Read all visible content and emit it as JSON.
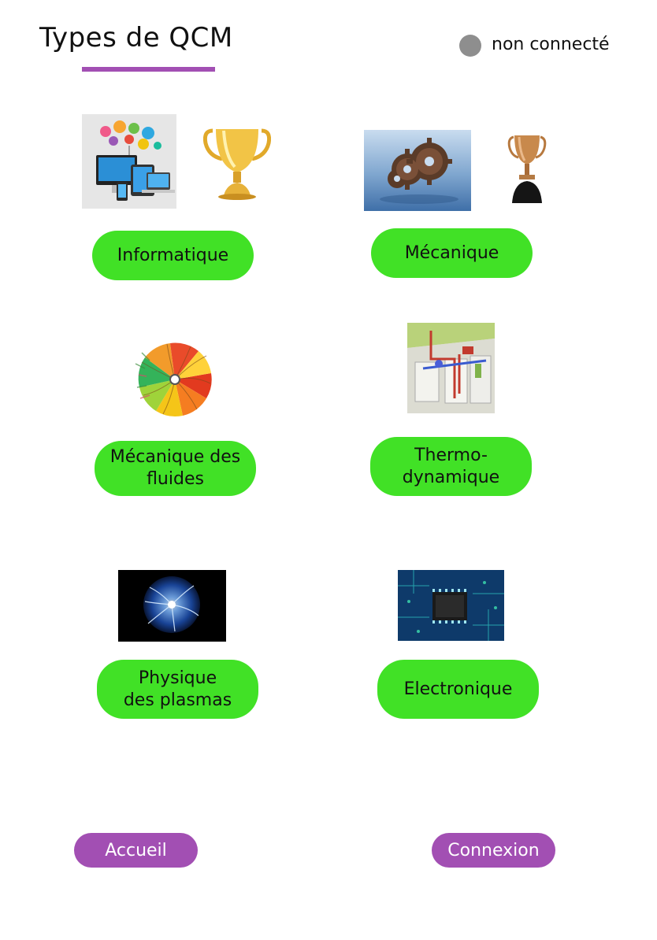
{
  "header": {
    "title": "Types de QCM",
    "status_text": "non connecté",
    "accent_color": "#a24fb3",
    "status_color": "#8e8e8e"
  },
  "categories": [
    {
      "label": "Informatique",
      "image": "computer-devices-cloud-image",
      "trophy": "gold-trophy-icon"
    },
    {
      "label": "Mécanique",
      "image": "gears-image",
      "trophy": "bronze-trophy-icon"
    },
    {
      "label": "Mécanique des fluides",
      "image": "fluid-turbine-image"
    },
    {
      "label": "Thermo-dynamique",
      "image": "thermal-building-image"
    },
    {
      "label": "Physique des plasmas",
      "image": "plasma-globe-image"
    },
    {
      "label": "Electronique",
      "image": "circuit-board-chip-image"
    }
  ],
  "button_color": "#41e126",
  "footer": {
    "accueil_label": "Accueil",
    "connexion_label": "Connexion"
  }
}
